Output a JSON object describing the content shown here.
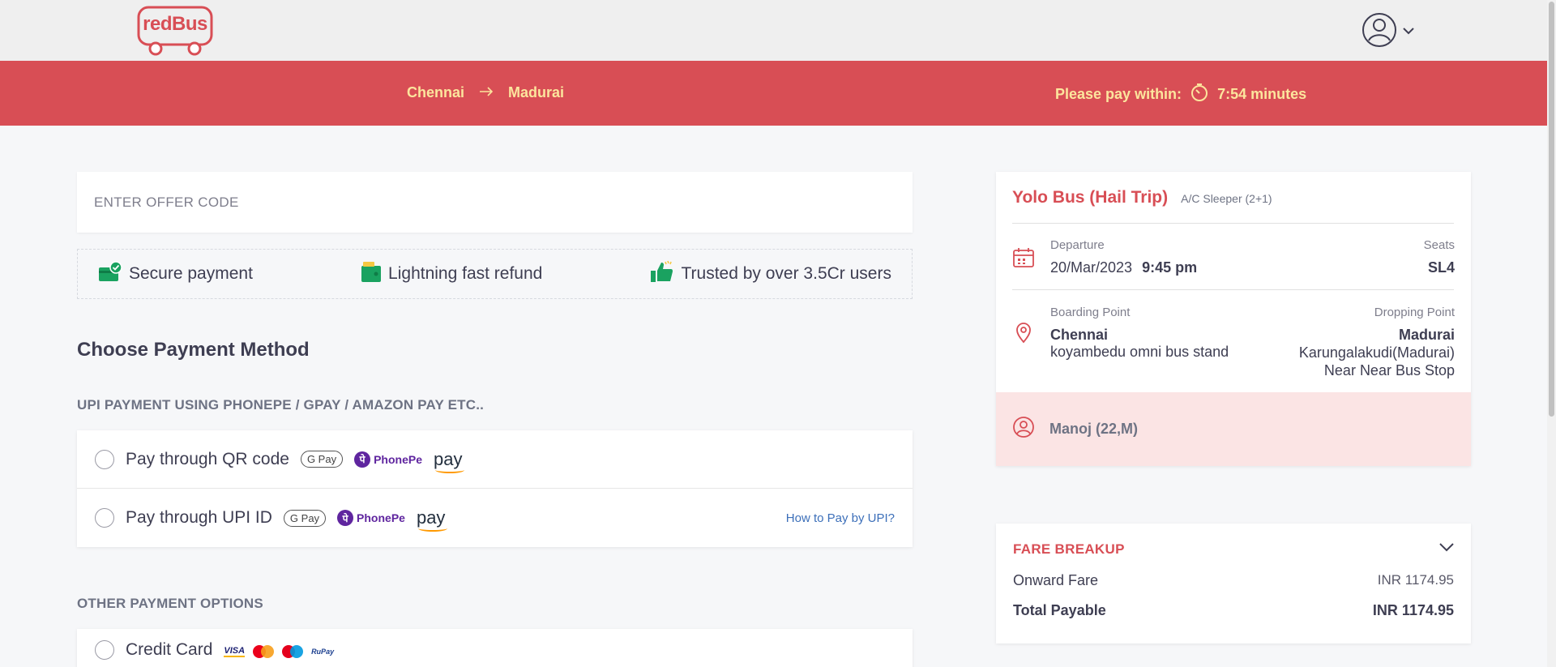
{
  "header": {
    "logo_text": "redBus"
  },
  "banner": {
    "from": "Chennai",
    "to": "Madurai",
    "pay_within_label": "Please pay within:",
    "timer_value": "7:54 minutes"
  },
  "offer": {
    "placeholder": "ENTER OFFER CODE"
  },
  "trust": {
    "secure": "Secure payment",
    "refund": "Lightning fast refund",
    "trusted": "Trusted by over 3.5Cr users"
  },
  "payment": {
    "title": "Choose Payment Method",
    "upi_heading": "UPI PAYMENT USING PHONEPE / GPAY / AMAZON PAY ETC..",
    "qr_label": "Pay through QR code",
    "upi_id_label": "Pay through UPI ID",
    "upi_help": "How to Pay by UPI?",
    "other_heading": "OTHER PAYMENT OPTIONS",
    "credit_card_label": "Credit Card",
    "brands": {
      "gpay": "G Pay",
      "phonepe": "PhonePe",
      "amazon": "pay",
      "visa": "VISA",
      "rupay": "RuPay"
    }
  },
  "trip": {
    "bus_name": "Yolo Bus (Hail Trip)",
    "bus_type": "A/C Sleeper (2+1)",
    "departure_label": "Departure",
    "departure_date": "20/Mar/2023",
    "departure_time": "9:45 pm",
    "seats_label": "Seats",
    "seats_value": "SL4",
    "boarding_label": "Boarding Point",
    "boarding_city": "Chennai",
    "boarding_place": "koyambedu omni bus stand",
    "dropping_label": "Dropping Point",
    "dropping_city": "Madurai",
    "dropping_place_line1": "Karungalakudi(Madurai)",
    "dropping_place_line2": "Near Near Bus Stop",
    "passenger": "Manoj (22,M)"
  },
  "fare": {
    "title": "FARE BREAKUP",
    "onward_label": "Onward Fare",
    "onward_value": "INR 1174.95",
    "total_label": "Total Payable",
    "total_value": "INR 1174.95"
  },
  "colors": {
    "brand_red": "#d84e55",
    "banner_text": "#fce59d",
    "trust_green": "#1aa260",
    "link_blue": "#3c6fb9"
  },
  "icons": [
    "redbus-logo",
    "user-icon",
    "chevron-down-icon",
    "arrow-right-icon",
    "timer-icon",
    "shield-wallet-icon",
    "wallet-icon",
    "thumbs-up-icon",
    "calendar-icon",
    "location-pin-icon",
    "passenger-icon"
  ]
}
